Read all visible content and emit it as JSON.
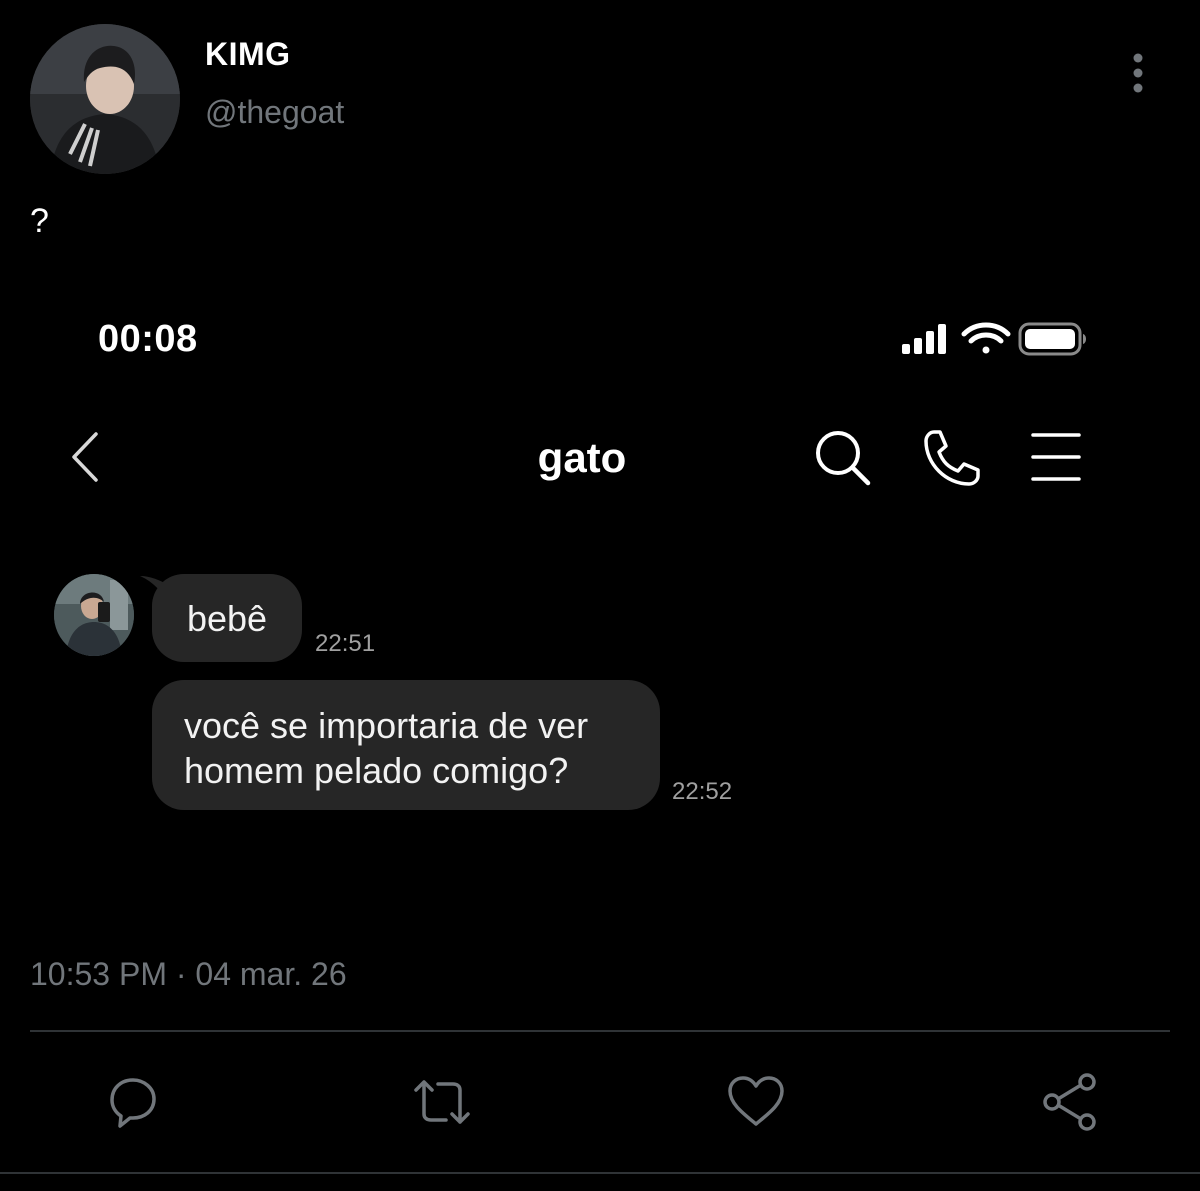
{
  "tweet": {
    "author": {
      "display_name": "KIMG",
      "handle": "@thegoat"
    },
    "text": "?",
    "timestamp": "10:53 PM",
    "separator": "·",
    "date": "04 mar. 26",
    "meta_line": "10:53 PM · 04 mar. 26"
  },
  "embedded_screenshot": {
    "status_bar": {
      "time": "00:08",
      "icons": [
        "cellular-signal-icon",
        "wifi-icon",
        "battery-icon"
      ]
    },
    "chat_header": {
      "title": "gato",
      "icons": [
        "back-chevron-icon",
        "search-icon",
        "phone-icon",
        "menu-icon"
      ]
    },
    "messages": [
      {
        "text": "bebê",
        "time": "22:51"
      },
      {
        "text": "você se importaria de ver homem pelado comigo?",
        "time": "22:52"
      }
    ]
  },
  "actions": {
    "icons": [
      "reply-icon",
      "retweet-icon",
      "like-icon",
      "share-icon"
    ]
  },
  "colors": {
    "background": "#000000",
    "text_primary": "#ffffff",
    "text_secondary": "#71767b",
    "bubble": "#262626",
    "divider": "#2f3336"
  }
}
